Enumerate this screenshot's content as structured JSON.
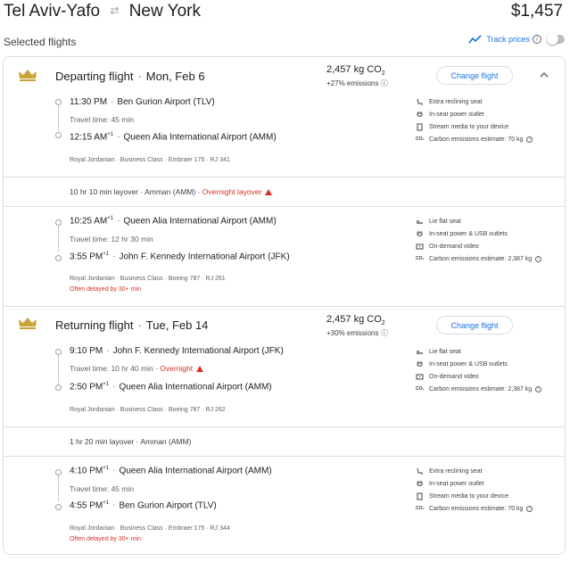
{
  "header": {
    "origin": "Tel Aviv-Yafo",
    "destination": "New York",
    "price": "$1,457"
  },
  "selected": {
    "label": "Selected flights",
    "track_label": "Track prices"
  },
  "change_label": "Change flight",
  "departing": {
    "title": "Departing flight",
    "date": "Mon, Feb 6",
    "co2": "2,457 kg CO",
    "co2_pct": "+27% emissions",
    "seg1": {
      "dep_time": "11:30 PM",
      "dep_airport": "Ben Gurion Airport (TLV)",
      "travel": "Travel time: 45 min",
      "arr_time": "12:15 AM",
      "arr_sup": "+1",
      "arr_airport": "Queen Alia International Airport (AMM)",
      "airline": "Royal Jordanian · Business Class · Embraer 175 · RJ 341",
      "amenities": [
        "Extra reclining seat",
        "In-seat power outlet",
        "Stream media to your device",
        "Carbon emissions estimate: 70 kg"
      ]
    },
    "layover": {
      "text": "10 hr 10 min layover · Amman (AMM) · ",
      "overnight": "Overnight layover"
    },
    "seg2": {
      "dep_time": "10:25 AM",
      "dep_sup": "+1",
      "dep_airport": "Queen Alia International Airport (AMM)",
      "travel": "Travel time: 12 hr 30 min",
      "arr_time": "3:55 PM",
      "arr_sup": "+1",
      "arr_airport": "John F. Kennedy International Airport (JFK)",
      "airline": "Royal Jordanian · Business Class · Boeing 787 · RJ 261",
      "delay": "Often delayed by 30+ min",
      "amenities": [
        "Lie flat seat",
        "In-seat power & USB outlets",
        "On-demand video",
        "Carbon emissions estimate: 2,387 kg"
      ]
    }
  },
  "returning": {
    "title": "Returning flight",
    "date": "Tue, Feb 14",
    "co2": "2,457 kg CO",
    "co2_pct": "+30% emissions",
    "seg1": {
      "dep_time": "9:10 PM",
      "dep_airport": "John F. Kennedy International Airport (JFK)",
      "travel": "Travel time: 10 hr 40 min · ",
      "overnight": "Overnight",
      "arr_time": "2:50 PM",
      "arr_sup": "+1",
      "arr_airport": "Queen Alia International Airport (AMM)",
      "airline": "Royal Jordanian · Business Class · Boeing 787 · RJ 262",
      "amenities": [
        "Lie flat seat",
        "In-seat power & USB outlets",
        "On-demand video",
        "Carbon emissions estimate: 2,387 kg"
      ]
    },
    "layover": {
      "text": "1 hr 20 min layover · Amman (AMM)"
    },
    "seg2": {
      "dep_time": "4:10 PM",
      "dep_sup": "+1",
      "dep_airport": "Queen Alia International Airport (AMM)",
      "travel": "Travel time: 45 min",
      "arr_time": "4:55 PM",
      "arr_sup": "+1",
      "arr_airport": "Ben Gurion Airport (TLV)",
      "airline": "Royal Jordanian · Business Class · Embraer 175 · RJ 344",
      "delay": "Often delayed by 30+ min",
      "amenities": [
        "Extra reclining seat",
        "In-seat power outlet",
        "Stream media to your device",
        "Carbon emissions estimate: 70 kg"
      ]
    }
  }
}
